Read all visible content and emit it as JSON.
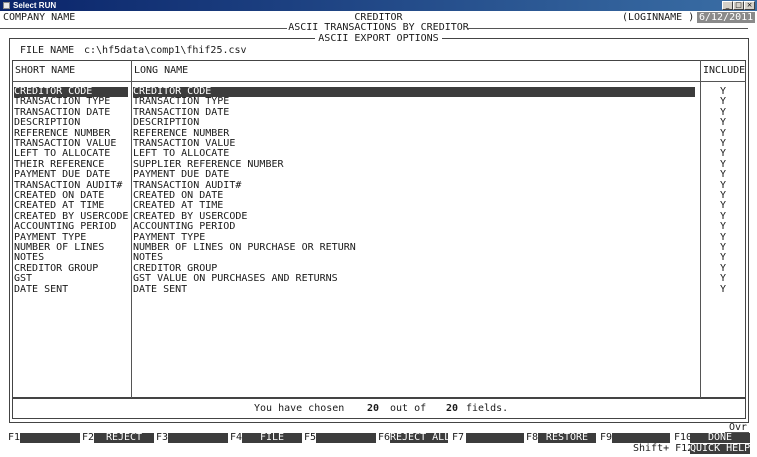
{
  "window": {
    "title": "Select RUN",
    "min": "_",
    "max": "□",
    "close": "×"
  },
  "header": {
    "company": "COMPANY NAME",
    "module": "CREDITOR",
    "login": "(LOGINNAME )",
    "date": "6/12/2011",
    "subtitle": "ASCII TRANSACTIONS BY CREDITOR",
    "section_title": "ASCII EXPORT OPTIONS"
  },
  "file": {
    "label": "FILE NAME",
    "value": "c:\\hf5data\\comp1\\fhif25.csv"
  },
  "columns": {
    "short": "SHORT NAME",
    "long": "LONG NAME",
    "include": "INCLUDE"
  },
  "fields": [
    {
      "short": "CREDITOR CODE",
      "long": "CREDITOR CODE",
      "include": "Y"
    },
    {
      "short": "TRANSACTION TYPE",
      "long": "TRANSACTION TYPE",
      "include": "Y"
    },
    {
      "short": "TRANSACTION DATE",
      "long": "TRANSACTION DATE",
      "include": "Y"
    },
    {
      "short": "DESCRIPTION",
      "long": "DESCRIPTION",
      "include": "Y"
    },
    {
      "short": "REFERENCE NUMBER",
      "long": "REFERENCE NUMBER",
      "include": "Y"
    },
    {
      "short": "TRANSACTION VALUE",
      "long": "TRANSACTION VALUE",
      "include": "Y"
    },
    {
      "short": "LEFT TO ALLOCATE",
      "long": "LEFT TO ALLOCATE",
      "include": "Y"
    },
    {
      "short": "THEIR REFERENCE",
      "long": "SUPPLIER REFERENCE NUMBER",
      "include": "Y"
    },
    {
      "short": "PAYMENT DUE DATE",
      "long": "PAYMENT DUE DATE",
      "include": "Y"
    },
    {
      "short": "TRANSACTION AUDIT#",
      "long": "TRANSACTION AUDIT#",
      "include": "Y"
    },
    {
      "short": "CREATED ON DATE",
      "long": "CREATED ON DATE",
      "include": "Y"
    },
    {
      "short": "CREATED AT TIME",
      "long": "CREATED AT TIME",
      "include": "Y"
    },
    {
      "short": "CREATED BY USERCODE",
      "long": "CREATED BY USERCODE",
      "include": "Y"
    },
    {
      "short": "ACCOUNTING PERIOD",
      "long": "ACCOUNTING PERIOD",
      "include": "Y"
    },
    {
      "short": "PAYMENT TYPE",
      "long": "PAYMENT TYPE",
      "include": "Y"
    },
    {
      "short": "NUMBER OF LINES",
      "long": "NUMBER OF LINES ON PURCHASE OR RETURN",
      "include": "Y"
    },
    {
      "short": "NOTES",
      "long": "NOTES",
      "include": "Y"
    },
    {
      "short": "CREDITOR GROUP",
      "long": "CREDITOR GROUP",
      "include": "Y"
    },
    {
      "short": "GST",
      "long": "GST VALUE ON PURCHASES AND RETURNS",
      "include": "Y"
    },
    {
      "short": "DATE SENT",
      "long": "DATE SENT",
      "include": "Y"
    }
  ],
  "summary": {
    "prefix": "You have chosen",
    "chosen": "20",
    "middle": "out of",
    "total": "20",
    "suffix": "fields."
  },
  "mode": "Ovr",
  "fkeys": [
    {
      "key": "F1",
      "label": ""
    },
    {
      "key": "F2",
      "label": "REJECT"
    },
    {
      "key": "F3",
      "label": ""
    },
    {
      "key": "F4",
      "label": "FILE"
    },
    {
      "key": "F5",
      "label": ""
    },
    {
      "key": "F6",
      "label": "REJECT ALL"
    },
    {
      "key": "F7",
      "label": ""
    },
    {
      "key": "F8",
      "label": "RESTORE"
    },
    {
      "key": "F9",
      "label": ""
    },
    {
      "key": "F10",
      "label": "DONE"
    }
  ],
  "shift_fkey": {
    "key": "Shift+ F12",
    "label": "QUICK HELP"
  }
}
